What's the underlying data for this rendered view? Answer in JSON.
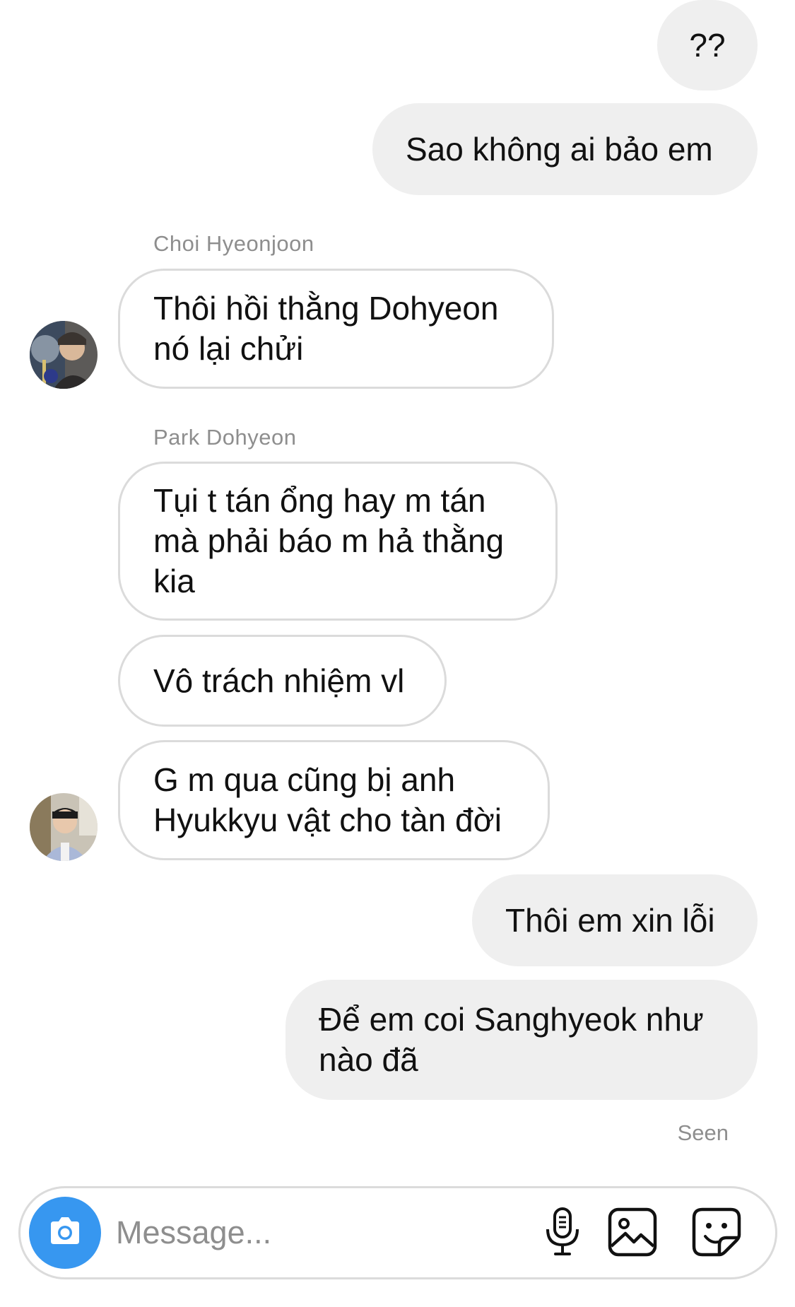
{
  "thread": {
    "messages": [
      {
        "direction": "outgoing",
        "text": "??"
      },
      {
        "direction": "outgoing",
        "text": "Sao không ai bảo em"
      },
      {
        "direction": "incoming",
        "sender": "Choi Hyeonjoon",
        "text": "Thôi hồi thằng Dohyeon\nnó lại chửi"
      },
      {
        "direction": "incoming",
        "sender": "Park Dohyeon",
        "text": "Tụi t tán ổng hay m tán\nmà phải báo m hả thằng\nkia"
      },
      {
        "direction": "incoming",
        "text": "Vô trách nhiệm vl"
      },
      {
        "direction": "incoming",
        "text": "G m qua cũng bị anh\nHyukkyu vật cho tàn đời"
      },
      {
        "direction": "outgoing",
        "text": "Thôi em xin lỗi"
      },
      {
        "direction": "outgoing",
        "text": "Để em coi Sanghyeok như\nnào đã"
      }
    ],
    "seen_label": "Seen"
  },
  "composer": {
    "placeholder": "Message...",
    "icons": [
      "camera-icon",
      "microphone-icon",
      "gallery-icon",
      "sticker-icon"
    ]
  },
  "colors": {
    "outgoing_bubble": "#efefef",
    "incoming_border": "#dbdbdb",
    "meta_text": "#8e8e8e",
    "camera_button": "#3797f0"
  }
}
